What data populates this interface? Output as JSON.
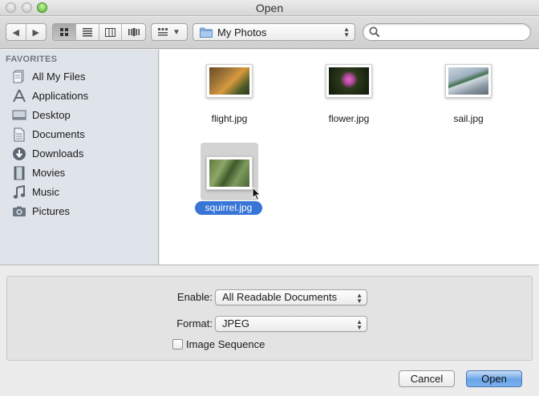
{
  "window": {
    "title": "Open"
  },
  "toolbar": {
    "location": "My Photos",
    "search": {
      "value": "",
      "placeholder": ""
    }
  },
  "sidebar": {
    "header": "FAVORITES",
    "items": [
      {
        "label": "All My Files",
        "icon": "all-files-icon"
      },
      {
        "label": "Applications",
        "icon": "applications-icon"
      },
      {
        "label": "Desktop",
        "icon": "desktop-icon"
      },
      {
        "label": "Documents",
        "icon": "documents-icon"
      },
      {
        "label": "Downloads",
        "icon": "downloads-icon"
      },
      {
        "label": "Movies",
        "icon": "movies-icon"
      },
      {
        "label": "Music",
        "icon": "music-icon"
      },
      {
        "label": "Pictures",
        "icon": "pictures-icon"
      }
    ]
  },
  "files": [
    {
      "name": "flight.jpg",
      "selected": false
    },
    {
      "name": "flower.jpg",
      "selected": false
    },
    {
      "name": "sail.jpg",
      "selected": false
    },
    {
      "name": "squirrel.jpg",
      "selected": true
    }
  ],
  "options": {
    "enable_label": "Enable:",
    "enable_value": "All Readable Documents",
    "format_label": "Format:",
    "format_value": "JPEG",
    "image_sequence_label": "Image Sequence",
    "image_sequence_checked": false
  },
  "buttons": {
    "cancel": "Cancel",
    "open": "Open"
  },
  "colors": {
    "selection": "#3875d7",
    "default_button": "#6aa4e6",
    "sidebar_bg": "#dfe4ea"
  }
}
